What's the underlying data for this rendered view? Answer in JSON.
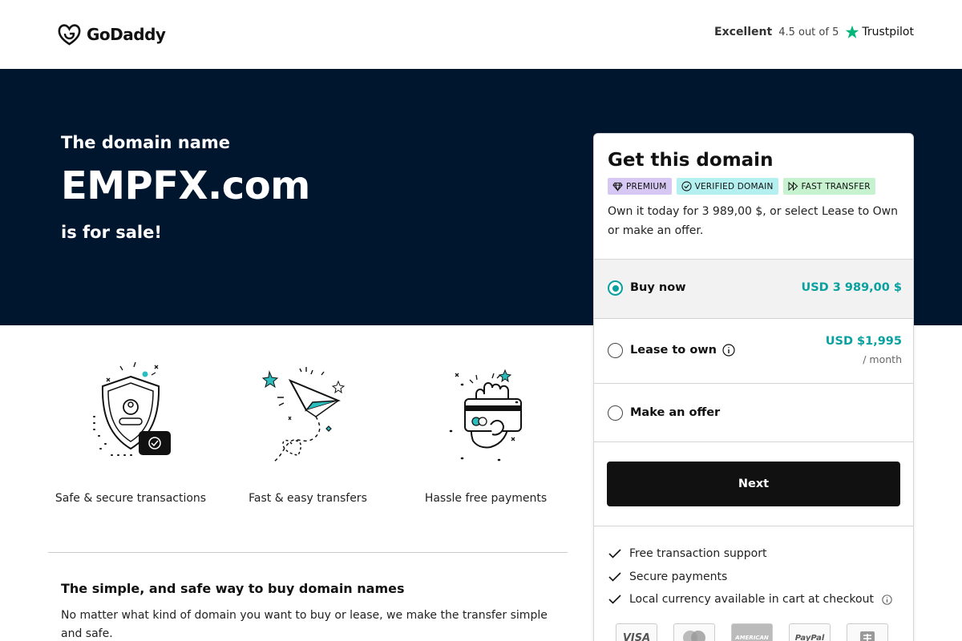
{
  "header": {
    "logo_text": "GoDaddy",
    "rating_word": "Excellent",
    "rating_score": "4.5 out of 5",
    "rating_brand": "Trustpilot"
  },
  "hero": {
    "line1": "The domain name",
    "domain": "EMPFX.com",
    "line2": "is for sale!"
  },
  "features": [
    {
      "label": "Safe & secure transactions",
      "icon": "shield-user-icon"
    },
    {
      "label": "Fast & easy transfers",
      "icon": "paper-plane-icon"
    },
    {
      "label": "Hassle free payments",
      "icon": "hand-card-icon"
    }
  ],
  "info": {
    "title": "The simple, and safe way to buy domain names",
    "text": "No matter what kind of domain you want to buy or lease, we make the transfer simple and safe."
  },
  "card": {
    "title": "Get this domain",
    "badges": [
      "PREMIUM",
      "VERIFIED DOMAIN",
      "FAST TRANSFER"
    ],
    "description": "Own it today for 3 989,00 $, or select Lease to Own or make an offer.",
    "options": [
      {
        "label": "Buy now",
        "price": "USD 3 989,00 $",
        "selected": true
      },
      {
        "label": "Lease to own",
        "price": "USD $1,995",
        "sub": "/ month",
        "selected": false
      },
      {
        "label": "Make an offer",
        "selected": false
      }
    ],
    "next_label": "Next",
    "benefits": [
      "Free transaction support",
      "Secure payments",
      "Local currency available in cart at checkout"
    ],
    "payment_methods": [
      "VISA",
      "Mastercard",
      "AMERICAN EXPRESS",
      "PayPal",
      "Bank"
    ]
  },
  "colors": {
    "hero_bg": "#00152e",
    "accent": "#09a0a0",
    "button_bg": "#111111"
  }
}
